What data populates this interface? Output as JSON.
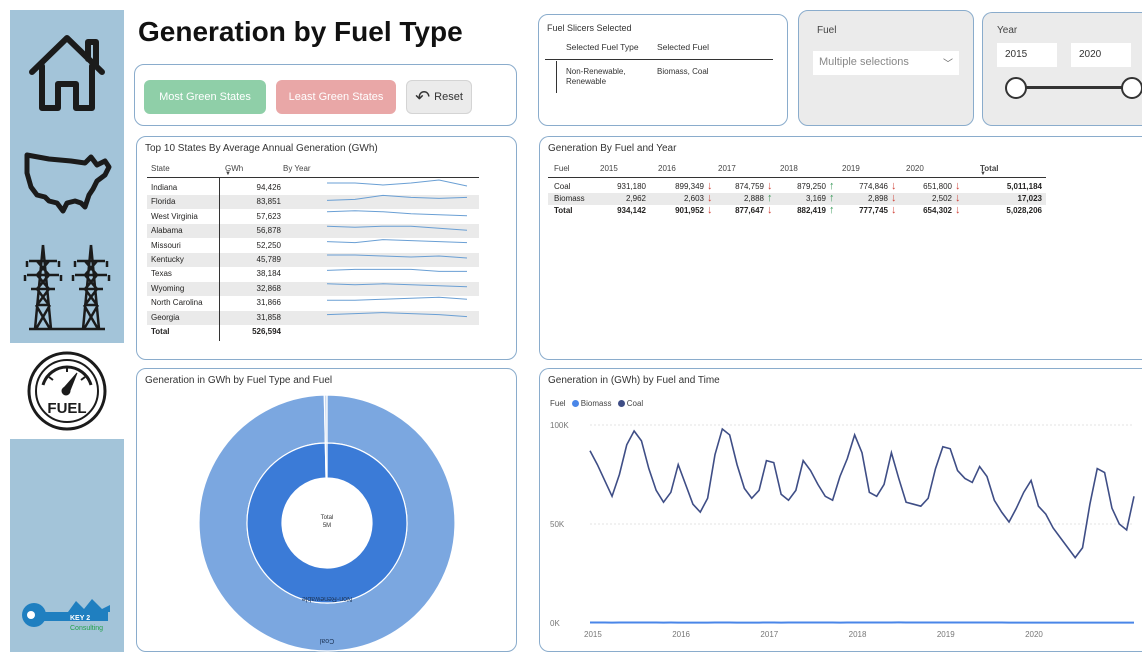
{
  "page": {
    "title": "Generation by Fuel Type"
  },
  "nav": {
    "items": [
      {
        "name": "home",
        "icon": "home-icon"
      },
      {
        "name": "states",
        "icon": "usa-map-icon"
      },
      {
        "name": "power",
        "icon": "power-tower-icon"
      },
      {
        "name": "fuel",
        "icon": "fuel-gauge-icon",
        "label": "FUEL",
        "active": true
      }
    ],
    "logo_text_1": "KEY 2",
    "logo_text_2": "Consulting"
  },
  "buttons": {
    "most_green": "Most Green States",
    "least_green": "Least Green States",
    "reset": "Reset"
  },
  "slicers": {
    "title": "Fuel Slicers Selected",
    "col1": "Selected Fuel Type",
    "col2": "Selected Fuel",
    "fuel_type": "Non-Renewable,\nRenewable",
    "fuel": "Biomass, Coal"
  },
  "fuel_filter": {
    "label": "Fuel",
    "value": "Multiple selections"
  },
  "year_filter": {
    "label": "Year",
    "from": "2015",
    "to": "2020"
  },
  "top10": {
    "title": "Top 10 States By Average Annual Generation (GWh)",
    "col_state": "State",
    "col_gwh": "GWh",
    "col_year": "By Year",
    "rows": [
      {
        "state": "Indiana",
        "gwh": "94,426"
      },
      {
        "state": "Florida",
        "gwh": "83,851"
      },
      {
        "state": "West Virginia",
        "gwh": "57,623"
      },
      {
        "state": "Alabama",
        "gwh": "56,878"
      },
      {
        "state": "Missouri",
        "gwh": "52,250"
      },
      {
        "state": "Kentucky",
        "gwh": "45,789"
      },
      {
        "state": "Texas",
        "gwh": "38,184"
      },
      {
        "state": "Wyoming",
        "gwh": "32,868"
      },
      {
        "state": "North Carolina",
        "gwh": "31,866"
      },
      {
        "state": "Georgia",
        "gwh": "31,858"
      }
    ],
    "total_label": "Total",
    "total_value": "526,594"
  },
  "matrix": {
    "title": "Generation By Fuel and Year",
    "col_fuel": "Fuel",
    "years": [
      "2015",
      "2016",
      "2017",
      "2018",
      "2019",
      "2020"
    ],
    "col_total": "Total",
    "rows": [
      {
        "fuel": "Coal",
        "values": [
          "931,180",
          "899,349",
          "874,759",
          "879,250",
          "774,846",
          "651,800"
        ],
        "arrows": [
          "",
          "down",
          "down",
          "up",
          "down",
          "down"
        ],
        "total": "5,011,184"
      },
      {
        "fuel": "Biomass",
        "values": [
          "2,962",
          "2,603",
          "2,888",
          "3,169",
          "2,898",
          "2,502"
        ],
        "arrows": [
          "",
          "down",
          "up",
          "up",
          "down",
          "down"
        ],
        "total": "17,023"
      },
      {
        "fuel": "Total",
        "values": [
          "934,142",
          "901,952",
          "877,647",
          "882,419",
          "777,745",
          "654,302"
        ],
        "arrows": [
          "",
          "down",
          "down",
          "up",
          "down",
          "down"
        ],
        "total": "5,028,206"
      }
    ]
  },
  "donut": {
    "title": "Generation in GWh by Fuel Type and Fuel",
    "center_label": "Total",
    "center_value": "5M",
    "inner_label": "Non-Renewable",
    "outer_label": "Coal"
  },
  "line": {
    "title": "Generation in (GWh) by Fuel and Time",
    "legend_title": "Fuel",
    "series_names": [
      "Biomass",
      "Coal"
    ],
    "colors": {
      "biomass": "#4a86e8",
      "coal": "#3f4e86"
    },
    "y_ticks": [
      "100K",
      "50K",
      "0K"
    ],
    "x_ticks": [
      "2015",
      "2016",
      "2017",
      "2018",
      "2019",
      "2020"
    ]
  },
  "chart_data": [
    {
      "type": "line",
      "title": "Generation in (GWh) by Fuel and Time",
      "ylim": [
        0,
        100000
      ],
      "x_start": "2015-01",
      "x_step": "month",
      "series": [
        {
          "name": "Coal",
          "values": [
            87000,
            80000,
            72000,
            64000,
            75000,
            90000,
            97000,
            92000,
            78000,
            67000,
            61000,
            66000,
            80000,
            70000,
            60000,
            56000,
            63000,
            85000,
            98000,
            95000,
            80000,
            68000,
            63000,
            67000,
            82000,
            81000,
            65000,
            62000,
            67000,
            82000,
            77000,
            70000,
            64000,
            62000,
            74000,
            83000,
            95000,
            86000,
            66000,
            64000,
            70000,
            86000,
            73000,
            61000,
            60000,
            59000,
            63000,
            78000,
            89000,
            88000,
            77000,
            73000,
            71000,
            79000,
            74000,
            62000,
            56000,
            51000,
            58000,
            66000,
            72000,
            59000,
            55000,
            48000,
            43000,
            38000,
            33000,
            38000,
            60000,
            78000,
            76000,
            58000,
            50000,
            47000,
            64000
          ]
        },
        {
          "name": "Biomass",
          "values": [
            250,
            240,
            230,
            220,
            230,
            250,
            270,
            260,
            240,
            230,
            220,
            240,
            220,
            210,
            200,
            200,
            210,
            230,
            240,
            230,
            220,
            210,
            200,
            210,
            240,
            230,
            220,
            230,
            240,
            250,
            260,
            250,
            240,
            230,
            220,
            230,
            270,
            260,
            250,
            250,
            260,
            280,
            290,
            280,
            260,
            250,
            250,
            260,
            250,
            240,
            230,
            230,
            240,
            250,
            260,
            250,
            230,
            220,
            210,
            220,
            220,
            210,
            200,
            190,
            190,
            200,
            210,
            220,
            220,
            210,
            200,
            200,
            190,
            190,
            200
          ]
        }
      ]
    },
    {
      "type": "pie",
      "title": "Generation in GWh by Fuel Type and Fuel",
      "inner": [
        {
          "name": "Non-Renewable",
          "value": 5011184
        },
        {
          "name": "Renewable",
          "value": 17023
        }
      ],
      "outer": [
        {
          "name": "Coal",
          "value": 5011184
        },
        {
          "name": "Biomass",
          "value": 17023
        }
      ]
    }
  ]
}
